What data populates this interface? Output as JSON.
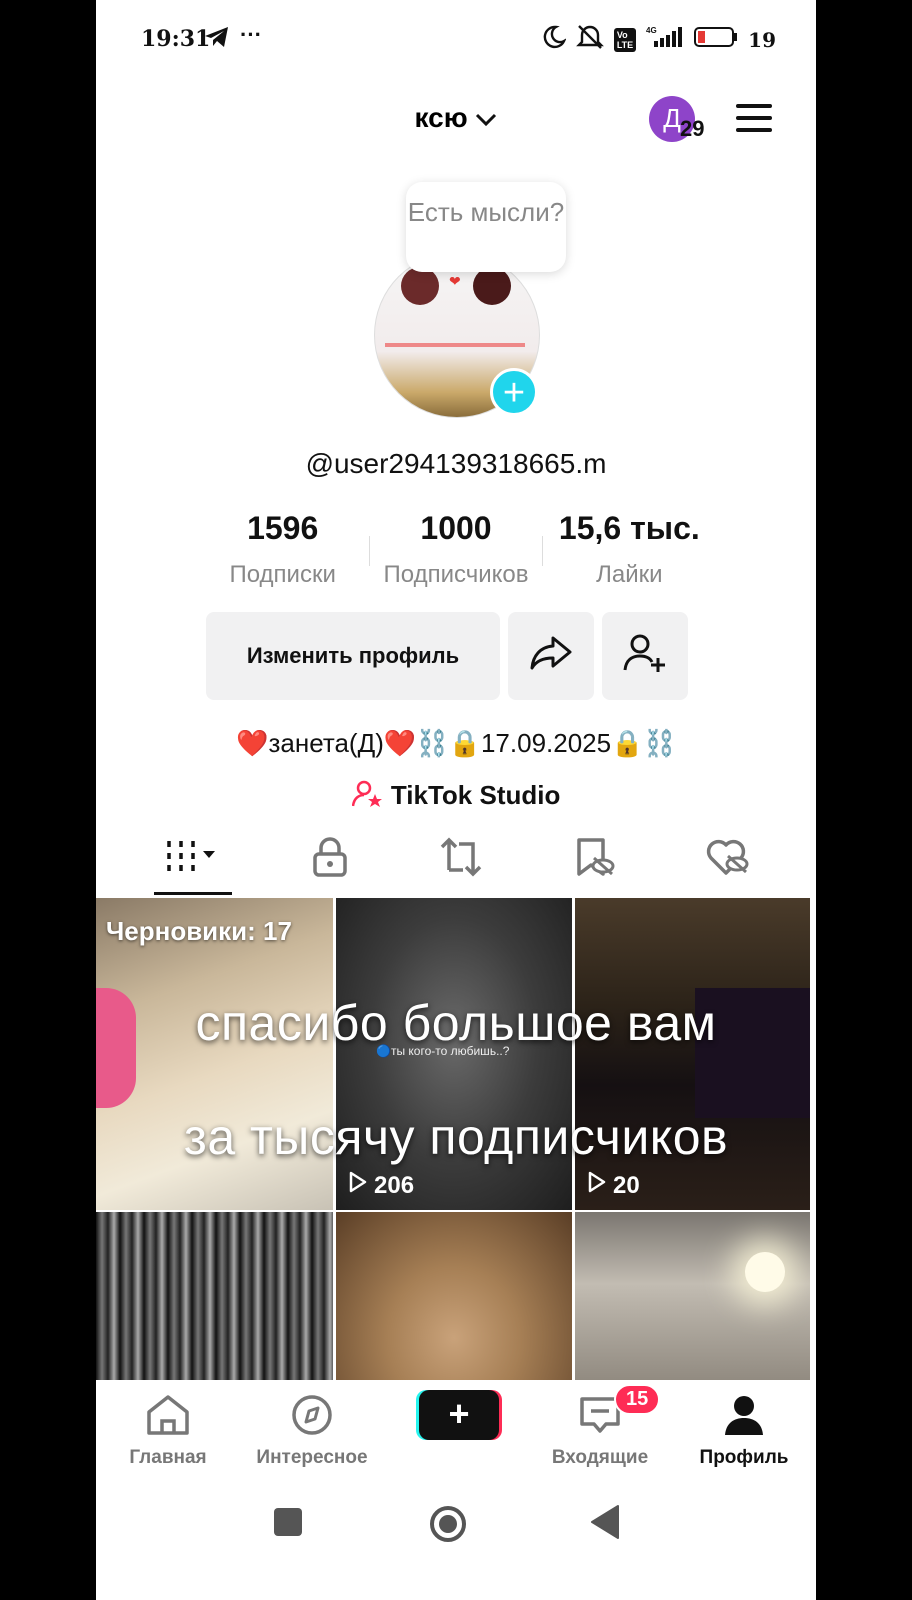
{
  "status_bar": {
    "time": "19:31",
    "battery": "19"
  },
  "header": {
    "title": "ксю",
    "avatar_letter": "Д",
    "notification_count": "29"
  },
  "bubble": {
    "text": "Есть мысли?"
  },
  "profile": {
    "handle": "@user294139318665.m",
    "bio": "❤️занета(Д)❤️⛓️🔒17.09.2025🔒⛓️",
    "studio_label": "TikTok Studio"
  },
  "stats": [
    {
      "value": "1596",
      "label": "Подписки"
    },
    {
      "value": "1000",
      "label": "Подписчиков"
    },
    {
      "value": "15,6 тыс.",
      "label": "Лайки"
    }
  ],
  "actions": {
    "edit_profile": "Изменить профиль"
  },
  "grid": {
    "drafts_label": "Черновики: 17",
    "overlay_line1": "спасибо большое вам",
    "overlay_line2": "за тысячу подписчиков",
    "cells": [
      {
        "views": ""
      },
      {
        "views": "206",
        "caption": "🔵ты кого-то любишь..?"
      },
      {
        "views": "20"
      },
      {
        "views": ""
      },
      {
        "views": ""
      },
      {
        "views": ""
      }
    ]
  },
  "nav": [
    {
      "label": "Главная"
    },
    {
      "label": "Интересное"
    },
    {
      "label": ""
    },
    {
      "label": "Входящие",
      "badge": "15"
    },
    {
      "label": "Профиль"
    }
  ]
}
